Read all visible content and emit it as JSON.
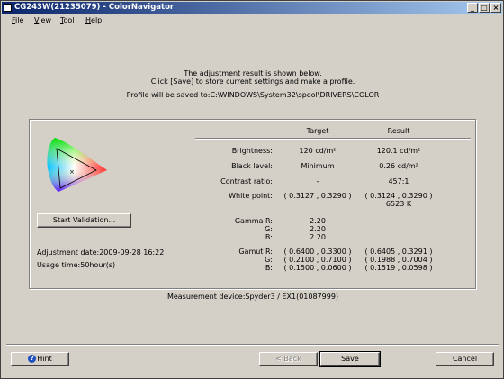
{
  "window": {
    "title": "CG243W(21235079) - ColorNavigator"
  },
  "menu": [
    {
      "label": "File",
      "key": "F"
    },
    {
      "label": "View",
      "key": "V"
    },
    {
      "label": "Tool",
      "key": "T"
    },
    {
      "label": "Help",
      "key": "H"
    }
  ],
  "intro": {
    "line1": "The adjustment result is shown below.",
    "line2": "Click [Save] to store current settings and make a profile.",
    "line3": "Profile will be saved to:C:\\WINDOWS\\System32\\spool\\DRIVERS\\COLOR"
  },
  "results": {
    "col_target": "Target",
    "col_result": "Result",
    "rows": [
      {
        "label": "Brightness:",
        "target": "120 cd/m²",
        "result": "120.1 cd/m²"
      },
      {
        "label": "Black level:",
        "target": "Minimum",
        "result": "0.26 cd/m²"
      },
      {
        "label": "Contrast ratio:",
        "target": "-",
        "result": "457:1"
      },
      {
        "label": "White point:",
        "target": "( 0.3127 , 0.3290 )",
        "result": "( 0.3124 , 0.3290 )",
        "result2": "6523 K"
      }
    ],
    "gamma": {
      "r_label": "Gamma R:",
      "g_label": "G:",
      "b_label": "B:",
      "r": "2.20",
      "g": "2.20",
      "b": "2.20"
    },
    "gamut": {
      "r_label": "Gamut R:",
      "g_label": "G:",
      "b_label": "B:",
      "r_target": "( 0.6400 , 0.3300 )",
      "g_target": "( 0.2100 , 0.7100 )",
      "b_target": "( 0.1500 , 0.0600 )",
      "r_result": "( 0.6405 , 0.3291 )",
      "g_result": "( 0.1988 , 0.7004 )",
      "b_result": "( 0.1519 , 0.0598 )"
    }
  },
  "left": {
    "start_validation": "Start Validation...",
    "adjustment_date": "Adjustment date:2009-09-28 16:22",
    "usage_time": "Usage time:50hour(s)"
  },
  "measurement_device": "Measurement device:Spyder3 / EX1(01087999)",
  "buttons": {
    "hint": "Hint",
    "back": "< Back",
    "save": "Save",
    "cancel": "Cancel"
  }
}
